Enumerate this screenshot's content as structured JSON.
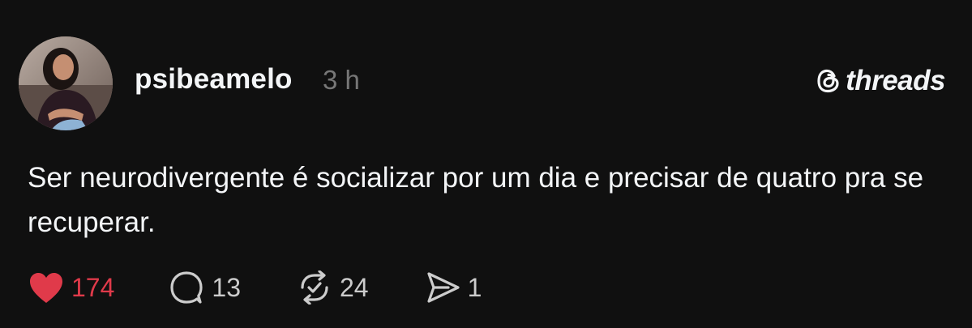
{
  "post": {
    "username": "psibeamelo",
    "timestamp": "3 h",
    "brand_name": "threads",
    "text": "Ser neurodivergente é socializar por um dia e precisar de quatro pra se recuperar.",
    "actions": {
      "likes": "174",
      "replies": "13",
      "reposts": "24",
      "shares": "1"
    }
  },
  "icons": {
    "avatar": "avatar-photo",
    "brand": "threads-logo-icon",
    "like": "heart-filled-icon",
    "reply": "comment-bubble-icon",
    "repost": "repost-icon",
    "share": "send-icon"
  },
  "colors": {
    "background": "#101010",
    "text": "#f3f5f7",
    "muted": "#777777",
    "like_red": "#e03a4a"
  }
}
